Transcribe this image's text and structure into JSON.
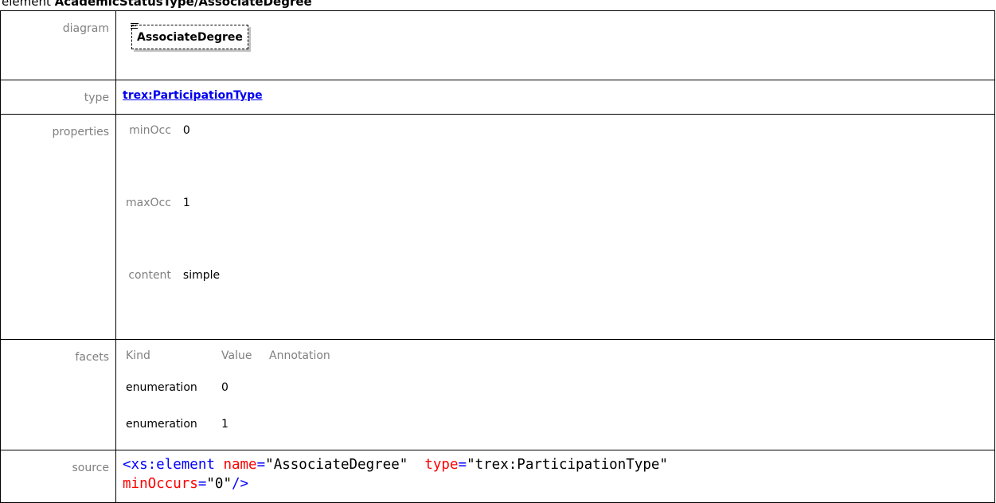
{
  "heading": {
    "prefix": "element ",
    "path": "AcademicStatusType/AssociateDegree"
  },
  "rows": {
    "diagram": {
      "label": "diagram",
      "box_text": "AssociateDegree"
    },
    "type": {
      "label": "type",
      "link_text": "trex:ParticipationType"
    },
    "properties": {
      "label": "properties",
      "items": [
        {
          "key": "minOcc",
          "value": "0"
        },
        {
          "key": "maxOcc",
          "value": "1"
        },
        {
          "key": "content",
          "value": "simple"
        }
      ]
    },
    "facets": {
      "label": "facets",
      "headers": {
        "kind": "Kind",
        "value": "Value",
        "annotation": "Annotation"
      },
      "items": [
        {
          "kind": "enumeration",
          "value": "0",
          "annotation": ""
        },
        {
          "kind": "enumeration",
          "value": "1",
          "annotation": ""
        }
      ]
    },
    "source": {
      "label": "source",
      "tag_open": "<xs:element",
      "attr_name": "name",
      "name_value": "\"AssociateDegree\"",
      "attr_type": "type",
      "type_value": "\"trex:ParticipationType\"",
      "attr_min": "minOccurs",
      "min_value": "\"0\"",
      "tag_close": "/>",
      "equals": "="
    }
  }
}
